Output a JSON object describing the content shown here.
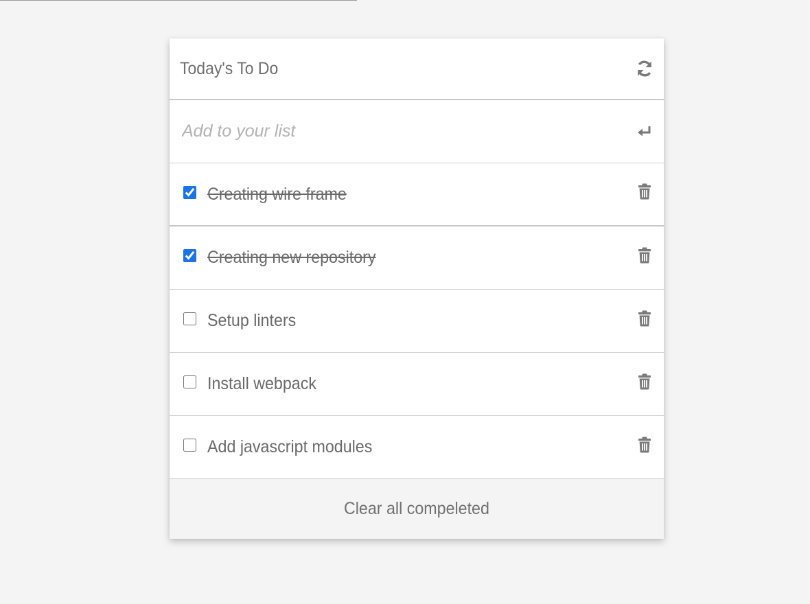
{
  "header": {
    "title": "Today's To Do",
    "refresh_icon": "refresh-icon"
  },
  "input": {
    "placeholder": "Add to your list",
    "value": "",
    "enter_icon": "enter-icon"
  },
  "tasks": [
    {
      "label": "Creating wire frame",
      "completed": true,
      "delete_icon": "trash-icon"
    },
    {
      "label": "Creating new repository",
      "completed": true,
      "delete_icon": "trash-icon"
    },
    {
      "label": "Setup linters",
      "completed": false,
      "delete_icon": "trash-icon"
    },
    {
      "label": "Install webpack",
      "completed": false,
      "delete_icon": "trash-icon"
    },
    {
      "label": "Add javascript modules",
      "completed": false,
      "delete_icon": "trash-icon"
    }
  ],
  "footer": {
    "clear_label": "Clear all compeleted"
  },
  "colors": {
    "background": "#f4f4f4",
    "card": "#ffffff",
    "text": "#6a6a6a",
    "placeholder": "#b3b3b3",
    "checkbox_accent": "#1a73e8",
    "icon": "#7a7a7a"
  }
}
